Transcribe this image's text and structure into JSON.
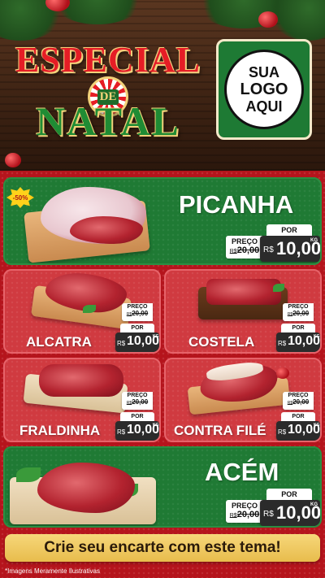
{
  "header": {
    "title_top": "ESPECIAL",
    "title_mid": "DE",
    "title_bottom": "NATAL",
    "logo_line1": "SUA",
    "logo_line2": "LOGO",
    "logo_line3": "AQUI"
  },
  "products": [
    {
      "name": "PICANHA",
      "old_label": "PREÇO",
      "old_currency": "R$",
      "old_price": "20,00",
      "new_label": "POR",
      "new_currency": "R$",
      "new_price": "10,00",
      "unit": "KG",
      "badge": "-50%"
    },
    {
      "name": "ALCATRA",
      "old_label": "PREÇO",
      "old_currency": "R$",
      "old_price": "20,00",
      "new_label": "POR",
      "new_currency": "R$",
      "new_price": "10,00",
      "unit": "KG"
    },
    {
      "name": "COSTELA",
      "old_label": "PREÇO",
      "old_currency": "R$",
      "old_price": "20,00",
      "new_label": "POR",
      "new_currency": "R$",
      "new_price": "10,00",
      "unit": "KG"
    },
    {
      "name": "FRALDINHA",
      "old_label": "PREÇO",
      "old_currency": "R$",
      "old_price": "20,00",
      "new_label": "POR",
      "new_currency": "R$",
      "new_price": "10,00",
      "unit": "KG"
    },
    {
      "name": "CONTRA FILÉ",
      "old_label": "PREÇO",
      "old_currency": "R$",
      "old_price": "20,00",
      "new_label": "POR",
      "new_currency": "R$",
      "new_price": "10,00",
      "unit": "KG"
    },
    {
      "name": "ACÉM",
      "old_label": "PREÇO",
      "old_currency": "R$",
      "old_price": "20,00",
      "new_label": "POR",
      "new_currency": "R$",
      "new_price": "10,00",
      "unit": "KG"
    }
  ],
  "cta": {
    "label": "Crie seu encarte com este tema!"
  },
  "footer": {
    "disclaimer": "*Imagens Meramente Ilustrativas"
  },
  "colors": {
    "background_red": "#b5141c",
    "card_green": "#1f7a34",
    "card_red": "#d03a40",
    "cta_gold": "#f6d77a"
  },
  "icons": {
    "badge": "starburst-discount-icon",
    "meat": "meat-cut-illustration"
  }
}
